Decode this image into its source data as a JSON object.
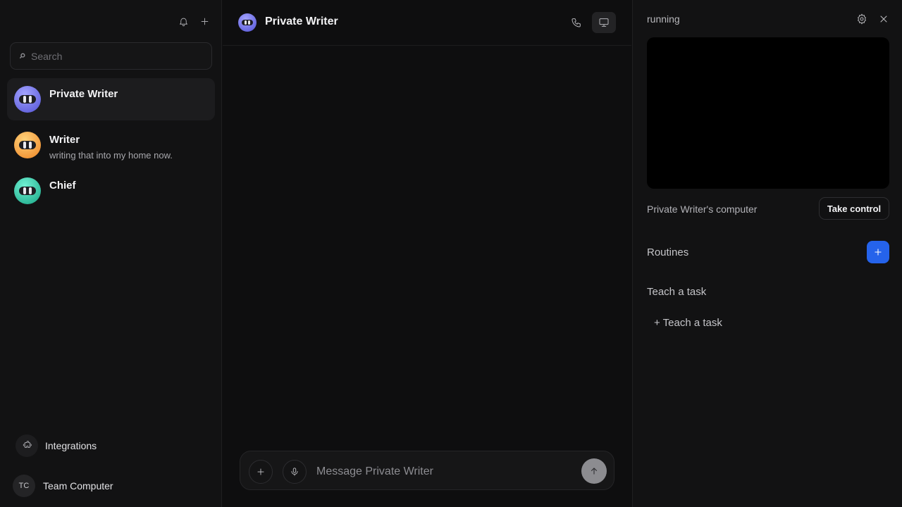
{
  "sidebar": {
    "search_placeholder": "Search",
    "chats": [
      {
        "name": "Private Writer",
        "preview": "",
        "active": true,
        "color_a": "#8d8dfc",
        "color_b": "#5a5ad8"
      },
      {
        "name": "Writer",
        "preview": "writing that into my home now.",
        "active": false,
        "color_a": "#fbc05a",
        "color_b": "#f08a2a"
      },
      {
        "name": "Chief",
        "preview": "",
        "active": false,
        "color_a": "#4fe0c0",
        "color_b": "#1fae8c"
      }
    ],
    "integrations_label": "Integrations",
    "team_initials": "TC",
    "team_name": "Team Computer"
  },
  "main": {
    "title": "Private Writer",
    "composer_placeholder": "Message Private Writer"
  },
  "right_panel": {
    "status": "running",
    "computer_label": "Private Writer's computer",
    "take_control_label": "Take control",
    "routines_label": "Routines",
    "teach_heading": "Teach a task",
    "teach_link": "+ Teach a task"
  },
  "colors": {
    "accent": "#2563eb",
    "background": "#0e0e0f",
    "panel": "#121213"
  }
}
